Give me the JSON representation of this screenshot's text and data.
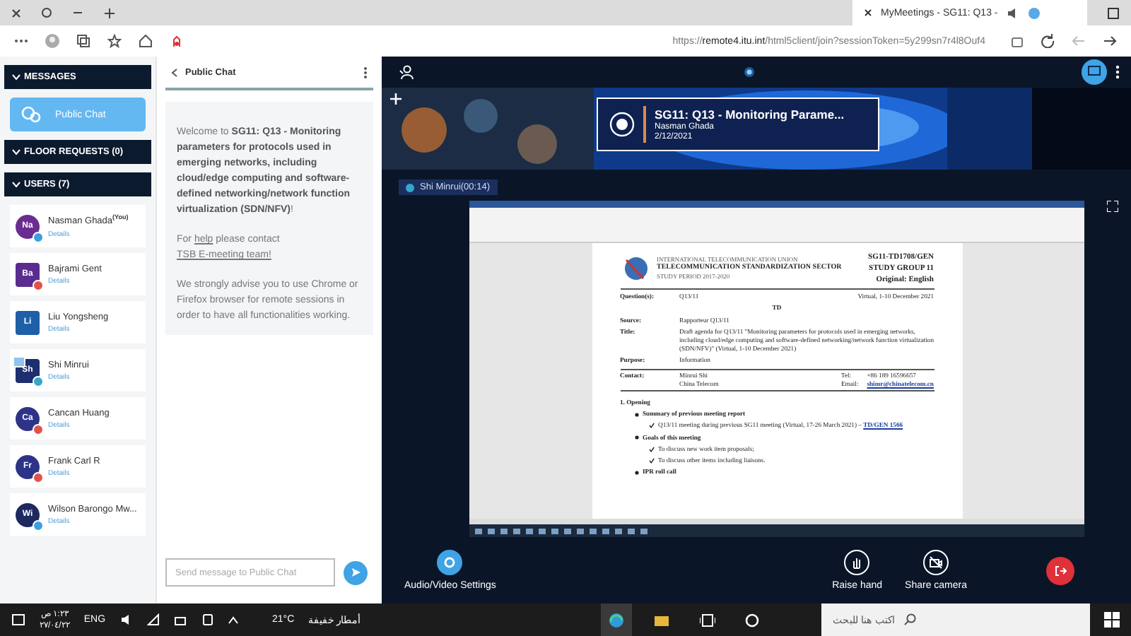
{
  "browser": {
    "tab_title": "MyMeetings - SG11: Q13 -",
    "url": "https://remote4.itu.int/html5client/join?sessionToken=5y299sn7r4l8Ouf4"
  },
  "sidebar": {
    "messages_header": "MESSAGES",
    "chats": [
      {
        "label": "Public Chat",
        "selected": true
      }
    ],
    "floor_header": "FLOOR REQUESTS (0)",
    "users_header": "USERS (7)",
    "users": [
      {
        "initials": "Na",
        "name": "Nasman Ghada",
        "you_tag": "(You)",
        "moderator": false,
        "presenter": false,
        "color": "#3b9fe0",
        "details": "Details"
      },
      {
        "initials": "Ba",
        "name": "Bajrami Gent",
        "moderator": true,
        "presenter": false,
        "color": "#e0524a",
        "details": "Details"
      },
      {
        "initials": "Li",
        "name": "Liu Yongsheng",
        "moderator": true,
        "presenter": false,
        "details": "Details"
      },
      {
        "initials": "Sh",
        "name": "Shi Minrui",
        "moderator": true,
        "presenter": true,
        "color": "#35a7c9",
        "details": "Details"
      },
      {
        "initials": "Ca",
        "name": "Cancan Huang",
        "moderator": false,
        "presenter": false,
        "color": "#e0524a",
        "details": "Details"
      },
      {
        "initials": "Fr",
        "name": "Frank Carl R",
        "moderator": false,
        "presenter": false,
        "color": "#e0524a",
        "details": "Details"
      },
      {
        "initials": "Wi",
        "name": "Wilson Barongo Mw...",
        "moderator": false,
        "presenter": false,
        "color": "#3b9fe0",
        "details": "Details"
      }
    ]
  },
  "chat": {
    "title": "Public Chat",
    "welcome": "Welcome to **SG11: Q13 - Monitoring parameters for protocols used in emerging networks, including cloud/edge computing and software-defined networking/network function virtualization (SDN/NFV)**!",
    "help": [
      {
        "kind": "text",
        "text": "For"
      },
      {
        "kind": "link",
        "text": "help"
      },
      {
        "kind": "text",
        "text": "please contact"
      },
      {
        "kind": "link",
        "text": "TSB E-meeting team!"
      }
    ],
    "advice": "We strongly advise you to use Chrome or Firefox browser for remote sessions in order to have all functionalities working.",
    "input": {
      "placeholder": "Send message to Public Chat"
    }
  },
  "stage": {
    "banner": {
      "title": "SG11: Q13 - Monitoring Parame...",
      "host": "Nasman Ghada",
      "date": "2/12/2021"
    },
    "presenter_label": "Shi Minrui(00:14)",
    "document": {
      "org_line": "INTERNATIONAL TELECOMMUNICATION UNION",
      "sector": "TELECOMMUNICATION STANDARDIZATION SECTOR",
      "period": "STUDY PERIOD 2017-2020",
      "doc_id": "SG11-TD1708/GEN",
      "group": "STUDY GROUP 11",
      "original": "Original: English",
      "fields": [
        {
          "kind": "pair",
          "label": "Question(s):",
          "value": "Q13/11",
          "extra": "Virtual, 1-10 December 2021"
        },
        {
          "kind": "center",
          "value": "TD"
        },
        {
          "kind": "pair",
          "label": "Source:",
          "value": "Rapporteur Q13/11"
        },
        {
          "kind": "pair",
          "label": "Title:",
          "value": "Draft agenda for Q13/11 \"Monitoring parameters for protocols used in emerging networks, including cloud/edge computing and software-defined networking/network function virtualization (SDN/NFV)\" (Virtual, 1-10 December 2021)"
        },
        {
          "kind": "pair",
          "label": "Purpose:",
          "value": "Information"
        },
        {
          "kind": "contact",
          "label": "Contact:",
          "value": "Minrui Shi",
          "value2": "China Telecom",
          "tel_label": "Tel:",
          "tel": "+86 189 16596657",
          "email_label": "Email:",
          "email": "shimr@chinatelecom.cn"
        }
      ],
      "agenda": [
        {
          "kind": "heading",
          "text": "1.   Opening"
        },
        {
          "kind": "bullet",
          "text": "Summary of previous meeting report"
        },
        {
          "kind": "check",
          "text": "Q13/11 meeting during previous SG11 meeting (Virtual, 17-26 March 2021) –",
          "link": "TD/GEN 1566"
        },
        {
          "kind": "bullet",
          "text": "Goals of this meeting"
        },
        {
          "kind": "check",
          "text": "To discuss new work item proposals;"
        },
        {
          "kind": "check",
          "text": "To discuss other items including liaisons."
        },
        {
          "kind": "bullet",
          "text": "IPR roll call"
        }
      ]
    },
    "controls": [
      {
        "kind": "settings",
        "label": "Audio/Video Settings"
      },
      {
        "kind": "hand",
        "label": "Raise hand"
      },
      {
        "kind": "camera",
        "label": "Share camera"
      }
    ]
  },
  "taskbar": {
    "search": {
      "placeholder": "اكتب هنا للبحث"
    },
    "weather": "أمطار خفيفة",
    "temperature": "21°C",
    "language": "ENG",
    "time": "١:٢٣ ص",
    "date": "٢٧/٠٤/٢٢"
  }
}
